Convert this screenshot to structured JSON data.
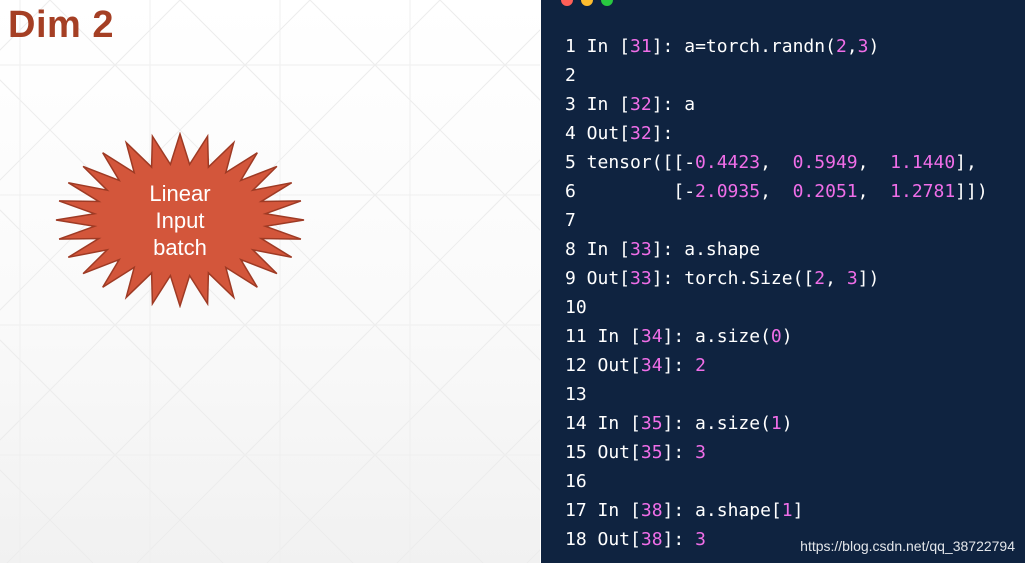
{
  "slide": {
    "title": "Dim 2",
    "starburst": {
      "lines": [
        "Linear",
        "Input",
        "batch"
      ],
      "fill_color": "#d3563b"
    }
  },
  "code_editor": {
    "window_controls": [
      "close",
      "minimize",
      "maximize"
    ],
    "colors": {
      "background": "#0f2340",
      "text": "#ffffff",
      "number": "#f06ee8"
    },
    "lines": [
      [
        [
          "1 In [",
          "t"
        ],
        [
          "31",
          "n"
        ],
        [
          "]: a=torch.randn(",
          "t"
        ],
        [
          "2",
          "n"
        ],
        [
          ",",
          "t"
        ],
        [
          "3",
          "n"
        ],
        [
          ")",
          "t"
        ]
      ],
      [
        [
          "2",
          "t"
        ]
      ],
      [
        [
          "3 In [",
          "t"
        ],
        [
          "32",
          "n"
        ],
        [
          "]: a",
          "t"
        ]
      ],
      [
        [
          "4 Out[",
          "t"
        ],
        [
          "32",
          "n"
        ],
        [
          "]:",
          "t"
        ]
      ],
      [
        [
          "5 tensor([[-",
          "t"
        ],
        [
          "0.4423",
          "n"
        ],
        [
          ",  ",
          "t"
        ],
        [
          "0.5949",
          "n"
        ],
        [
          ",  ",
          "t"
        ],
        [
          "1.1440",
          "n"
        ],
        [
          "],",
          "t"
        ]
      ],
      [
        [
          "6         [-",
          "t"
        ],
        [
          "2.0935",
          "n"
        ],
        [
          ",  ",
          "t"
        ],
        [
          "0.2051",
          "n"
        ],
        [
          ",  ",
          "t"
        ],
        [
          "1.2781",
          "n"
        ],
        [
          "]])",
          "t"
        ]
      ],
      [
        [
          "7",
          "t"
        ]
      ],
      [
        [
          "8 In [",
          "t"
        ],
        [
          "33",
          "n"
        ],
        [
          "]: a.shape",
          "t"
        ]
      ],
      [
        [
          "9 Out[",
          "t"
        ],
        [
          "33",
          "n"
        ],
        [
          "]: torch.Size([",
          "t"
        ],
        [
          "2",
          "n"
        ],
        [
          ", ",
          "t"
        ],
        [
          "3",
          "n"
        ],
        [
          "])",
          "t"
        ]
      ],
      [
        [
          "10",
          "t"
        ]
      ],
      [
        [
          "11 In [",
          "t"
        ],
        [
          "34",
          "n"
        ],
        [
          "]: a.size(",
          "t"
        ],
        [
          "0",
          "n"
        ],
        [
          ")",
          "t"
        ]
      ],
      [
        [
          "12 Out[",
          "t"
        ],
        [
          "34",
          "n"
        ],
        [
          "]: ",
          "t"
        ],
        [
          "2",
          "n"
        ]
      ],
      [
        [
          "13",
          "t"
        ]
      ],
      [
        [
          "14 In [",
          "t"
        ],
        [
          "35",
          "n"
        ],
        [
          "]: a.size(",
          "t"
        ],
        [
          "1",
          "n"
        ],
        [
          ")",
          "t"
        ]
      ],
      [
        [
          "15 Out[",
          "t"
        ],
        [
          "35",
          "n"
        ],
        [
          "]: ",
          "t"
        ],
        [
          "3",
          "n"
        ]
      ],
      [
        [
          "16",
          "t"
        ]
      ],
      [
        [
          "17 In [",
          "t"
        ],
        [
          "38",
          "n"
        ],
        [
          "]: a.shape[",
          "t"
        ],
        [
          "1",
          "n"
        ],
        [
          "]",
          "t"
        ]
      ],
      [
        [
          "18 Out[",
          "t"
        ],
        [
          "38",
          "n"
        ],
        [
          "]: ",
          "t"
        ],
        [
          "3",
          "n"
        ]
      ]
    ]
  },
  "watermark": "https://blog.csdn.net/qq_38722794"
}
